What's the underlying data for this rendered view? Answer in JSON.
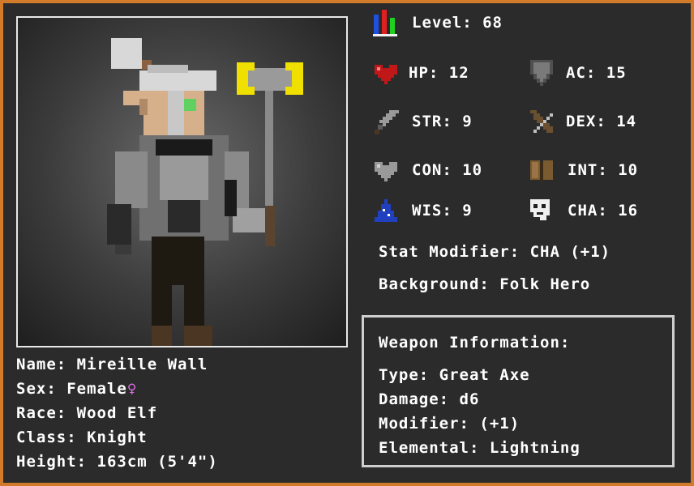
{
  "character": {
    "name_label": "Name:",
    "name": "Mireille Wall",
    "sex_label": "Sex:",
    "sex": "Female",
    "sex_symbol": "♀",
    "race_label": "Race:",
    "race": "Wood Elf",
    "class_label": "Class:",
    "class": "Knight",
    "height_label": "Height:",
    "height": "163cm (5'4\")"
  },
  "stats": {
    "level_label": "Level:",
    "level": "68",
    "hp_label": "HP:",
    "hp": "12",
    "ac_label": "AC:",
    "ac": "15",
    "str_label": "STR:",
    "str": "9",
    "dex_label": "DEX:",
    "dex": "14",
    "con_label": "CON:",
    "con": "10",
    "int_label": "INT:",
    "int": "10",
    "wis_label": "WIS:",
    "wis": "9",
    "cha_label": "CHA:",
    "cha": "16",
    "modifier_label": "Stat Modifier:",
    "modifier": "CHA (+1)",
    "background_label": "Background:",
    "background": "Folk Hero"
  },
  "weapon": {
    "title": "Weapon Information:",
    "type_label": "Type:",
    "type": "Great Axe",
    "damage_label": "Damage:",
    "damage": "d6",
    "modifier_label": "Modifier:",
    "modifier": "(+1)",
    "elemental_label": "Elemental:",
    "elemental": "Lightning"
  },
  "icons": {
    "level": "level-bars-icon",
    "hp": "heart-icon",
    "ac": "shield-icon",
    "str": "sword-icon",
    "dex": "bow-icon",
    "con": "grey-heart-icon",
    "int": "book-icon",
    "wis": "wizard-hat-icon",
    "cha": "mask-icon"
  },
  "colors": {
    "border": "#d07a2a",
    "panel": "#2b2b2b",
    "text": "#ffffff",
    "female_symbol": "#e070e8"
  }
}
